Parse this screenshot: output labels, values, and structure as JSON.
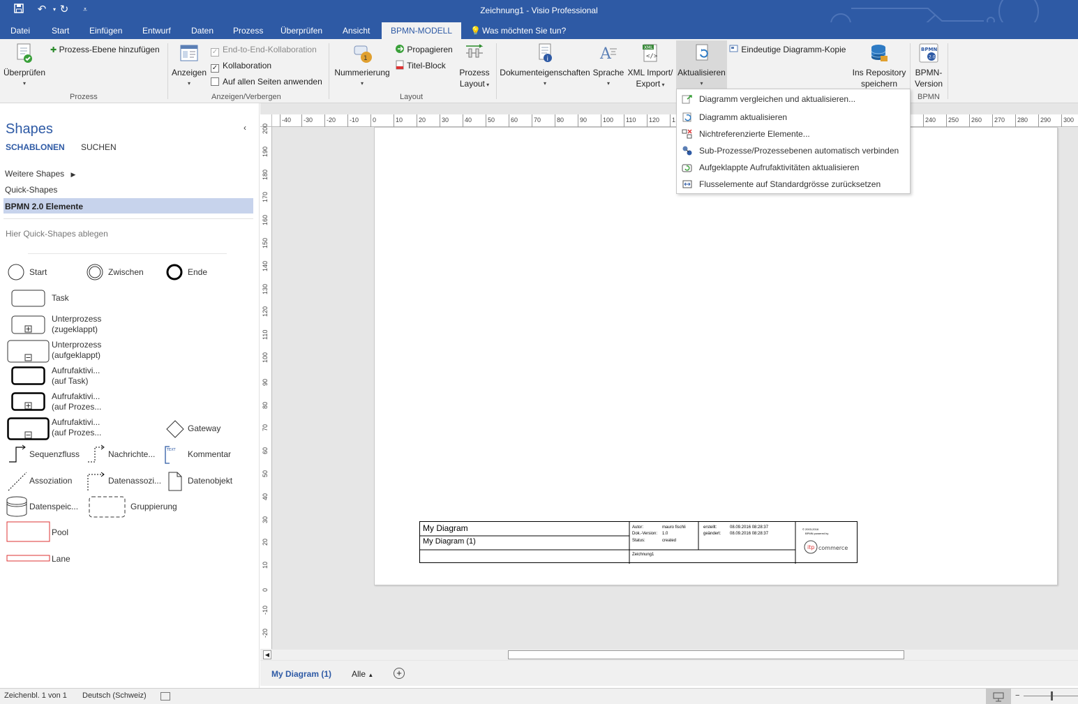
{
  "window": {
    "title": "Zeichnung1 - Visio Professional"
  },
  "quick_access": {
    "save": "save-icon",
    "undo": "undo-icon",
    "redo": "redo-icon",
    "customize": "customize-icon"
  },
  "tabs": [
    "Datei",
    "Start",
    "Einfügen",
    "Entwurf",
    "Daten",
    "Prozess",
    "Überprüfen",
    "Ansicht",
    "BPMN-MODELL"
  ],
  "tell_me": "Was möchten Sie tun?",
  "ribbon": {
    "ueberpruefen": "Überprüfen",
    "prozess_ebene": "Prozess-Ebene hinzufügen",
    "group_prozess": "Prozess",
    "anzeigen": "Anzeigen",
    "end_to_end": "End-to-End-Kollaboration",
    "kollaboration": "Kollaboration",
    "auf_allen_seiten": "Auf allen Seiten anwenden",
    "group_anzeigen": "Anzeigen/Verbergen",
    "nummerierung": "Nummerierung",
    "propagieren": "Propagieren",
    "titel_block": "Titel-Block",
    "prozess_layout_1": "Prozess",
    "prozess_layout_2": "Layout",
    "group_layout": "Layout",
    "dokumenteigenschaften": "Dokumenteigenschaften",
    "sprache": "Sprache",
    "xml_1": "XML Import/",
    "xml_2": "Export",
    "aktualisieren": "Aktualisieren",
    "eindeutige_kopie": "Eindeutige Diagramm-Kopie",
    "repository_1": "Ins Repository",
    "repository_2": "speichern",
    "bpmn_version_1": "BPMN-",
    "bpmn_version_2": "Version",
    "group_bpmn": "BPMN",
    "bpmn_badge_1": "BPMN",
    "bpmn_badge_2": "2.0",
    "xml_badge": "XML"
  },
  "menu": [
    "Diagramm vergleichen und aktualisieren...",
    "Diagramm aktualisieren",
    "Nichtreferenzierte Elemente...",
    "Sub-Prozesse/Prozessebenen automatisch verbinden",
    "Aufgeklappte Aufrufaktivitäten aktualisieren",
    "Flusselemente auf Standardgrösse zurücksetzen"
  ],
  "shapes_pane": {
    "title": "Shapes",
    "tab_schablonen": "SCHABLONEN",
    "tab_suchen": "SUCHEN",
    "weitere": "Weitere Shapes",
    "quick": "Quick-Shapes",
    "bpmn": "BPMN 2.0 Elemente",
    "hint": "Hier Quick-Shapes ablegen",
    "items": {
      "start": "Start",
      "zwischen": "Zwischen",
      "ende": "Ende",
      "task": "Task",
      "unterprozess_zu_1": "Unterprozess",
      "unterprozess_zu_2": "(zugeklappt)",
      "unterprozess_auf_1": "Unterprozess",
      "unterprozess_auf_2": "(aufgeklappt)",
      "aufruf_task_1": "Aufrufaktivi...",
      "aufruf_task_2": "(auf Task)",
      "aufruf_prozess_1": "Aufrufaktivi...",
      "aufruf_prozess_2": "(auf Prozes...",
      "aufruf_prozess2_1": "Aufrufaktivi...",
      "aufruf_prozess2_2": "(auf Prozes...",
      "gateway": "Gateway",
      "sequenzfluss": "Sequenzfluss",
      "nachrichten": "Nachrichte...",
      "kommentar": "Kommentar",
      "kommentar_tag": "TEXT",
      "assoziation": "Assoziation",
      "datenassoz": "Datenassozi...",
      "datenobjekt": "Datenobjekt",
      "datenspeic": "Datenspeic...",
      "gruppierung": "Gruppierung",
      "pool": "Pool",
      "lane": "Lane"
    }
  },
  "ruler": {
    "h": [
      "-40",
      "-30",
      "-20",
      "-10",
      "0",
      "10",
      "20",
      "30",
      "40",
      "50",
      "60",
      "70",
      "80",
      "90",
      "100",
      "110",
      "120",
      "1",
      "0",
      "240",
      "250",
      "260",
      "270",
      "280",
      "290",
      "300"
    ],
    "v": [
      "200",
      "190",
      "180",
      "170",
      "160",
      "150",
      "140",
      "130",
      "120",
      "110",
      "100",
      "90",
      "80",
      "70",
      "60",
      "50",
      "40",
      "30",
      "20",
      "10",
      "0",
      "-10",
      "-20"
    ]
  },
  "title_block": {
    "name": "My Diagram",
    "page": "My Diagram (1)",
    "autor_label": "Autor:",
    "autor": "mauro fischli",
    "version_label": "Dok.-Version:",
    "version": "1.0",
    "status_label": "Status:",
    "status": "created",
    "erstellt_label": "erstellt:",
    "erstellt": "08.09.2016 08:28:37",
    "geaendert_label": "geändert:",
    "geaendert": "08.09.2016 08:28:37",
    "file": "Zeichnung1",
    "copyright": "© 2003-2016",
    "powered": "BPMN powered by",
    "logo_text": "itp commerce"
  },
  "page_tabs": {
    "active": "My Diagram (1)",
    "all": "Alle",
    "add": "add-page-icon"
  },
  "status_bar": {
    "page": "Zeichenbl. 1 von 1",
    "language": "Deutsch (Schweiz)"
  }
}
